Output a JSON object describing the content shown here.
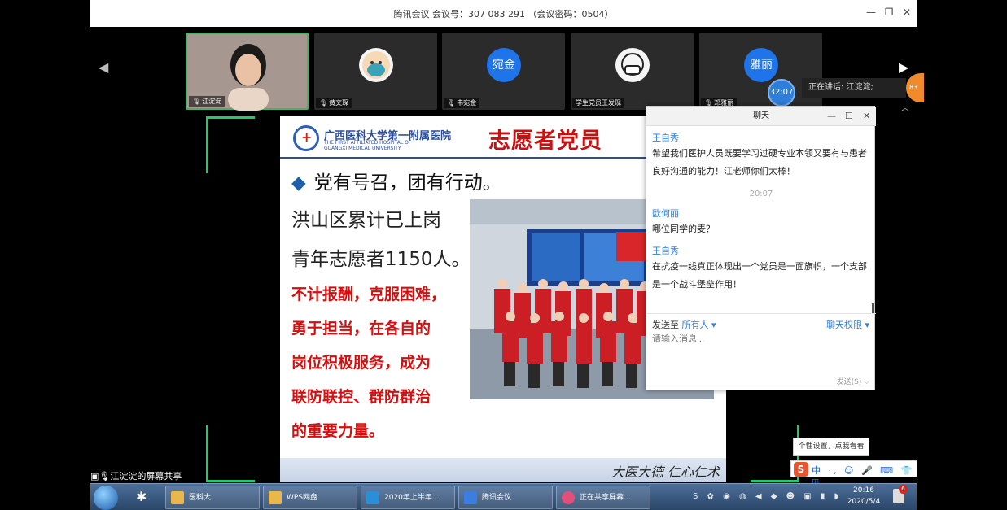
{
  "window": {
    "title": "腾讯会议 会议号：307 083 291 （会议密码：0504）",
    "minimize": "—",
    "restore": "❐",
    "close": "✕"
  },
  "participants": [
    {
      "name": "江淀淀",
      "avatar_text": "",
      "active": true
    },
    {
      "name": "黄文琛",
      "avatar_text": "",
      "active": false
    },
    {
      "name": "韦宛金",
      "avatar_text": "宛金",
      "active": false
    },
    {
      "name": "学生党员王发现",
      "avatar_text": "",
      "active": false
    },
    {
      "name": "邓雅丽",
      "avatar_text": "雅丽",
      "active": false
    }
  ],
  "strip": {
    "prev_arrow": "◀",
    "next_arrow": "▶",
    "timer": "32:07",
    "speaking_label": "正在讲话: 江淀淀;",
    "badge": "83",
    "collapse": "︿"
  },
  "slide": {
    "hospital_cn": "广西医科大学第一附属医院",
    "hospital_en_1": "THE FIRST AFFILIATED HOSPITAL OF",
    "hospital_en_2": "GUANGXI MEDICAL UNIVERSITY",
    "title": "志愿者党员",
    "bullet": "党有号召，团有行动。",
    "lines": [
      "洪山区累计已上岗",
      "青年志愿者1150人。"
    ],
    "red_lines": [
      "不计报酬，克服困难，",
      "勇于担当，在各自的",
      "岗位积极服务，成为",
      "联防联控、群防群治",
      "的重要力量。"
    ],
    "motto": "大医大德 仁心仁术"
  },
  "chat": {
    "title": "聊天",
    "messages": [
      {
        "sender": "王自秀",
        "text": "希望我们医护人员既要学习过硬专业本领又要有与患者良好沟通的能力！江老师你们太棒！"
      },
      {
        "timestamp": "20:07"
      },
      {
        "sender": "欧何丽",
        "text": "哪位同学的麦？"
      },
      {
        "sender": "王自秀",
        "text": "在抗疫一线真正体现出一个党员是一面旗帜，一个支部是一个战斗堡垒作用！"
      }
    ],
    "send_to_label": "发送至",
    "send_to_value": "所有人",
    "permission_label": "聊天权限",
    "input_placeholder": "请输入消息...",
    "send_button": "发送(S)"
  },
  "share_label": "江淀淀的屏幕共享",
  "tooltip": "个性设置，点我看看",
  "ime": {
    "logo": "S",
    "mode": "中 ·, ☺ 🎤 ⌨ 👕 ⊞"
  },
  "taskbar": {
    "tasks": [
      {
        "label": "医科大",
        "width": 116
      },
      {
        "label": "WPS网盘",
        "width": 116
      },
      {
        "label": "2020年上半年…",
        "width": 116
      },
      {
        "label": "腾讯会议",
        "width": 116
      },
      {
        "label": "正在共享屏幕…",
        "width": 116
      }
    ],
    "tray_icons": "S ✿ ◉ ◍ ◀ ◆ ☻ ▣ ▮ ◗",
    "time": "20:16",
    "date": "2020/5/4",
    "notification_count": "6"
  },
  "colors": {
    "accent_blue": "#2e7dd8",
    "slide_red": "#d40f0f",
    "active_green": "#3fb46d"
  }
}
